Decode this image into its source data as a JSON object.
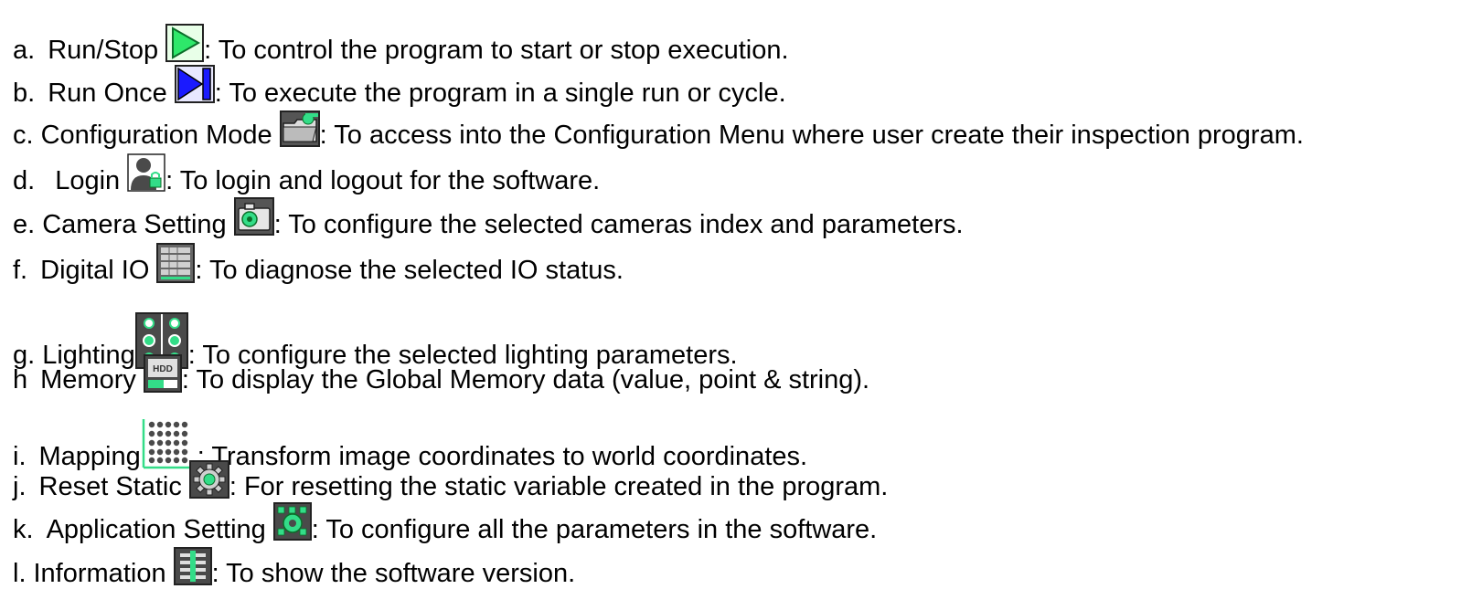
{
  "items": [
    {
      "marker": "a.",
      "name": "Run/Stop",
      "icon": "run-stop-icon",
      "desc": ": To control the program to start or stop execution."
    },
    {
      "marker": "b.",
      "name": "Run Once",
      "icon": "run-once-icon",
      "desc": ": To execute the program in a single run or cycle."
    },
    {
      "marker": "c.",
      "name": "Configuration Mode",
      "icon": "configuration-mode-icon",
      "desc": ": To access into the Configuration Menu where user create their inspection program."
    },
    {
      "marker": "d.",
      "name": "Login",
      "icon": "login-icon",
      "desc": ": To login and logout for the software."
    },
    {
      "marker": "e.",
      "name": "Camera Setting",
      "icon": "camera-setting-icon",
      "desc": ": To configure the selected cameras index and parameters."
    },
    {
      "marker": "f.",
      "name": "Digital IO",
      "icon": "digital-io-icon",
      "desc": ": To diagnose the selected IO status."
    },
    {
      "marker": "g.",
      "name": "Lighting",
      "icon": "lighting-icon",
      "desc": ": To configure the selected lighting parameters."
    },
    {
      "marker": "h",
      "name": "Memory",
      "icon": "memory-hdd-icon",
      "icon_text": "HDD",
      "desc": ": To display the Global Memory data (value, point & string)."
    },
    {
      "marker": "i.",
      "name": "Mapping",
      "icon": "mapping-grid-icon",
      "desc": ": Transform image coordinates to world coordinates."
    },
    {
      "marker": "j.",
      "name": "Reset Static",
      "icon": "reset-static-gear-icon",
      "desc": ": For resetting the static variable created in the program."
    },
    {
      "marker": "k.",
      "name": "Application Setting",
      "icon": "application-setting-icon",
      "desc": ": To configure all the parameters in the software."
    },
    {
      "marker": "l.",
      "name": "Information",
      "icon": "information-icon",
      "desc": ": To show the software version."
    }
  ],
  "colors": {
    "text": "#000000",
    "run_green": "#22dd55",
    "run_once_blue": "#1a1aff",
    "icon_accent_green": "#33dd88",
    "icon_dark": "#4a4a4a"
  }
}
